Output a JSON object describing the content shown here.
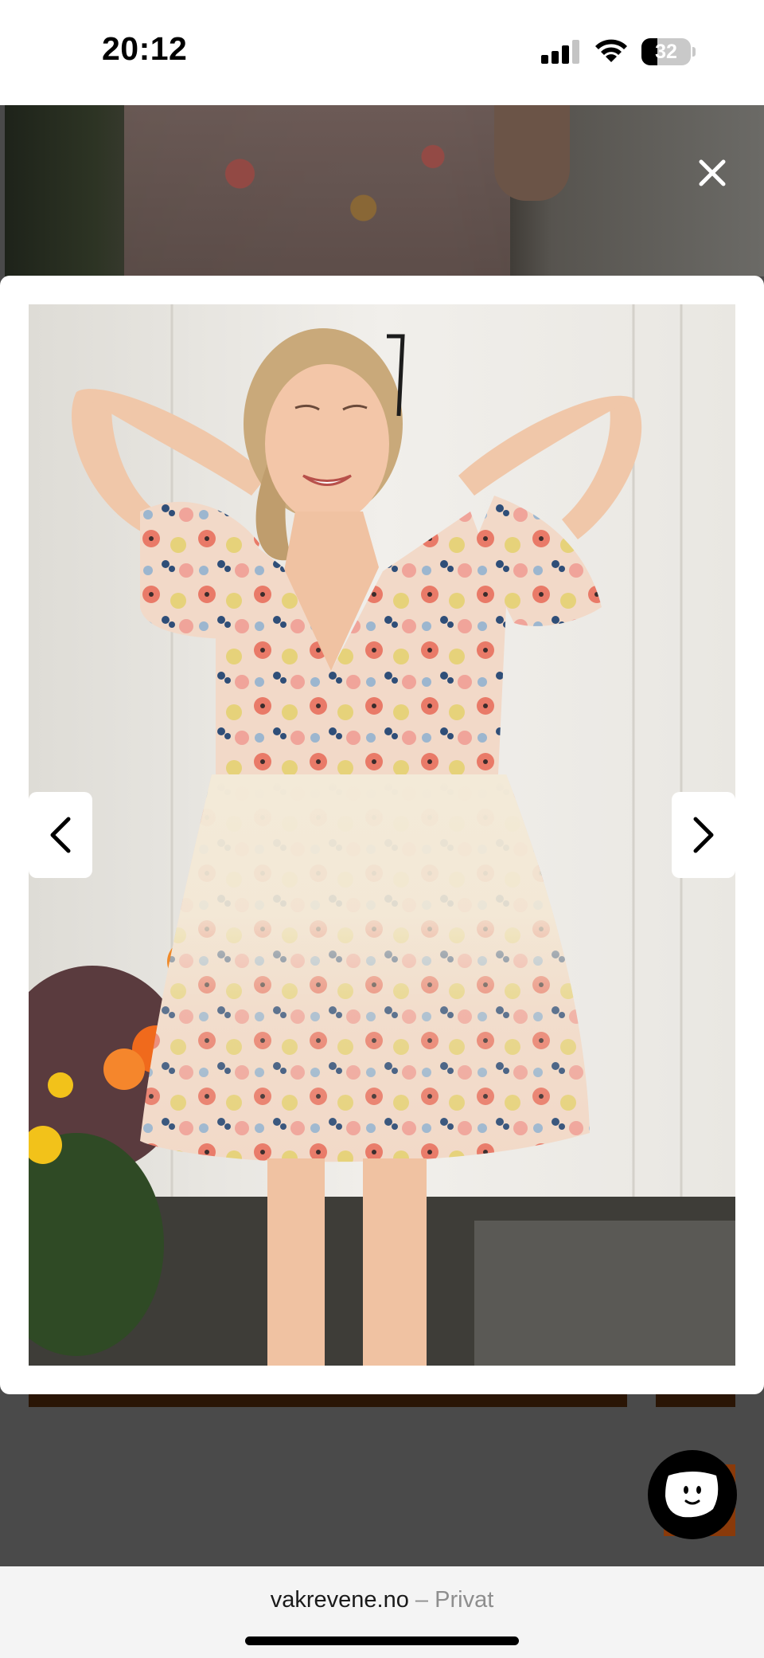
{
  "status_bar": {
    "time": "20:12",
    "battery_percent": "32",
    "battery_level": 0.32,
    "icons": [
      "signal-icon",
      "wifi-icon",
      "battery-icon"
    ]
  },
  "lightbox": {
    "close_icon": "close-icon",
    "prev_icon": "chevron-left-icon",
    "next_icon": "chevron-right-icon",
    "image_description_icon": "product-photo"
  },
  "chat_widget": {
    "icon": "chat-face-icon"
  },
  "browser": {
    "domain": "vakrevene.no",
    "separator": "–",
    "mode": "Privat"
  },
  "colors": {
    "overlay": "#4a4a4a",
    "background_button": "#2a1505",
    "chat_bg": "#000000"
  }
}
